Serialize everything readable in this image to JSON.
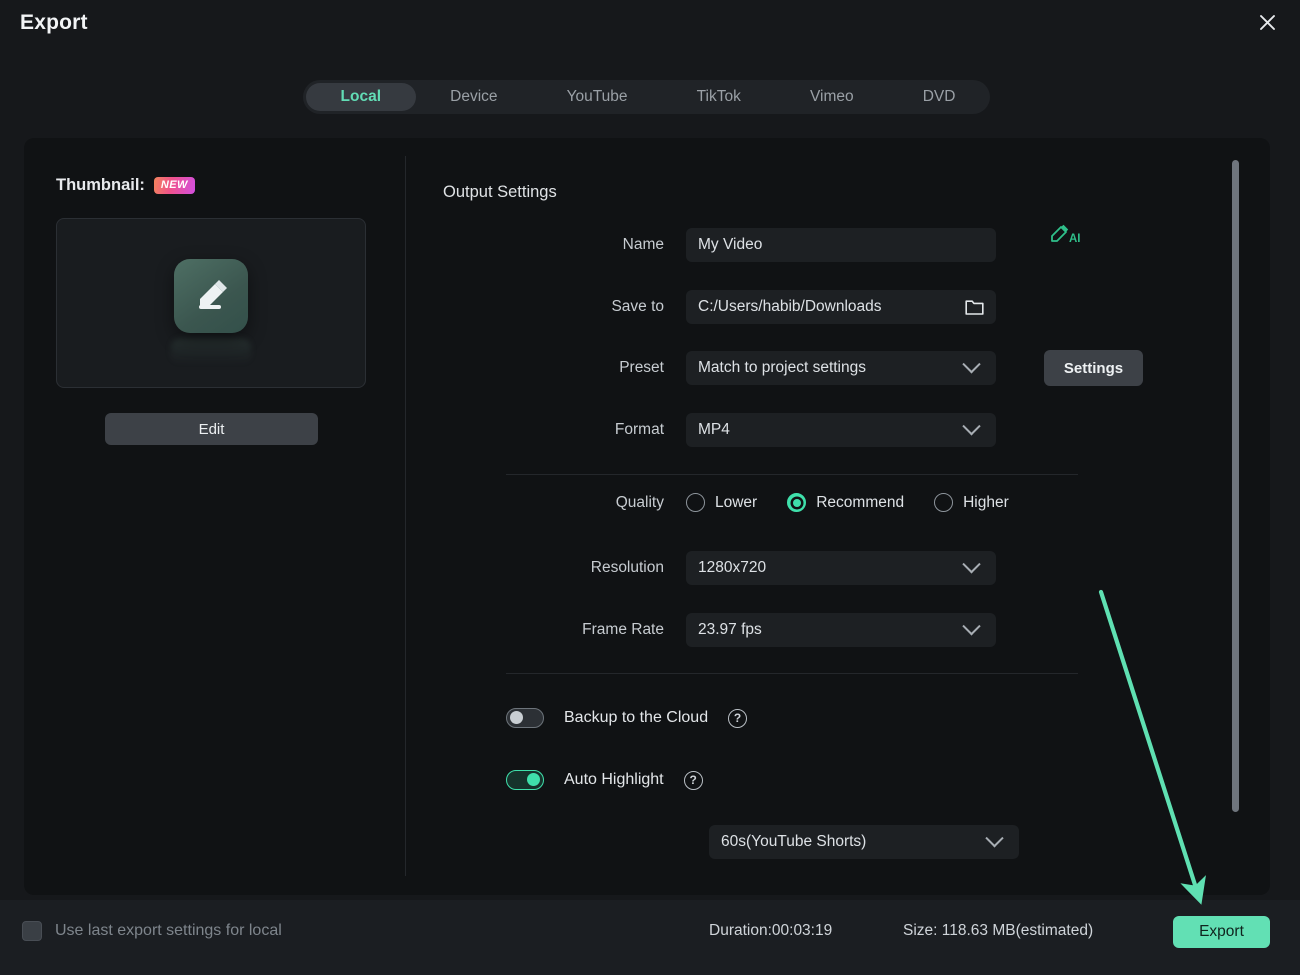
{
  "window": {
    "title": "Export",
    "close_icon": "close-icon"
  },
  "tabs": [
    {
      "label": "Local",
      "active": true
    },
    {
      "label": "Device",
      "active": false
    },
    {
      "label": "YouTube",
      "active": false
    },
    {
      "label": "TikTok",
      "active": false
    },
    {
      "label": "Vimeo",
      "active": false
    },
    {
      "label": "DVD",
      "active": false
    }
  ],
  "thumbnail": {
    "label": "Thumbnail:",
    "badge": "NEW",
    "preview_icon": "pencil-edit-icon",
    "edit_button": "Edit"
  },
  "output": {
    "section_title": "Output Settings",
    "name": {
      "label": "Name",
      "value": "My Video",
      "placeholder": "My Video",
      "ai_icon": "ai-pen-icon"
    },
    "save_to": {
      "label": "Save to",
      "value": "C:/Users/habib/Downloads",
      "folder_icon": "folder-icon"
    },
    "preset": {
      "label": "Preset",
      "value": "Match to project settings",
      "settings_button": "Settings"
    },
    "format": {
      "label": "Format",
      "value": "MP4"
    },
    "quality": {
      "label": "Quality",
      "options": [
        {
          "label": "Lower",
          "selected": false
        },
        {
          "label": "Recommend",
          "selected": true
        },
        {
          "label": "Higher",
          "selected": false
        }
      ]
    },
    "resolution": {
      "label": "Resolution",
      "value": "1280x720"
    },
    "frame_rate": {
      "label": "Frame Rate",
      "value": "23.97 fps"
    },
    "backup_cloud": {
      "label": "Backup to the Cloud",
      "on": false,
      "help_icon": "question-mark-icon",
      "help_glyph": "?"
    },
    "auto_highlight": {
      "label": "Auto Highlight",
      "on": true,
      "help_icon": "question-mark-icon",
      "help_glyph": "?"
    },
    "highlight_duration": {
      "value": "60s(YouTube Shorts)"
    }
  },
  "footer": {
    "use_last_settings": {
      "label": "Use last export settings for local",
      "checked": false
    },
    "duration": "Duration:00:03:19",
    "size": "Size: 118.63 MB(estimated)",
    "export_button": "Export"
  },
  "colors": {
    "accent": "#62e0b4",
    "accent_radio": "#3fe0ab",
    "background": "#16181b",
    "card": "#101214",
    "field": "#1d2023",
    "badge_gradient_start": "#f2845c",
    "badge_gradient_end": "#d34fe0",
    "annotation_arrow": "#5fe0b2"
  }
}
